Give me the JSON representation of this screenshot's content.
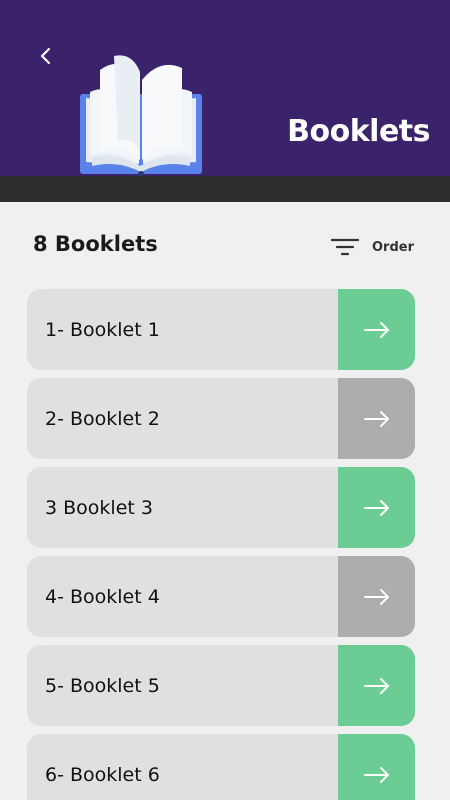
{
  "header": {
    "title": "Booklets",
    "background": "#3b236b",
    "back_icon": "chevron-left-icon",
    "illustration": "open-book-icon"
  },
  "summary": {
    "count_title": "8 Booklets",
    "order_label": "Order",
    "order_icon": "filter-lines-icon"
  },
  "booklets": [
    {
      "label": "1- Booklet 1",
      "status": "available",
      "color": "#6bcd94"
    },
    {
      "label": "2- Booklet 2",
      "status": "unavailable",
      "color": "#adadad"
    },
    {
      "label": "3 Booklet 3",
      "status": "available",
      "color": "#6bcd94"
    },
    {
      "label": "4- Booklet 4",
      "status": "unavailable",
      "color": "#adadad"
    },
    {
      "label": "5- Booklet 5",
      "status": "available",
      "color": "#6bcd94"
    },
    {
      "label": "6- Booklet 6",
      "status": "available",
      "color": "#6bcd94"
    }
  ],
  "colors": {
    "accent_green": "#6bcd94",
    "disabled_grey": "#adadad",
    "card_background": "#e0e0e0",
    "page_background": "#f0f0f0"
  }
}
